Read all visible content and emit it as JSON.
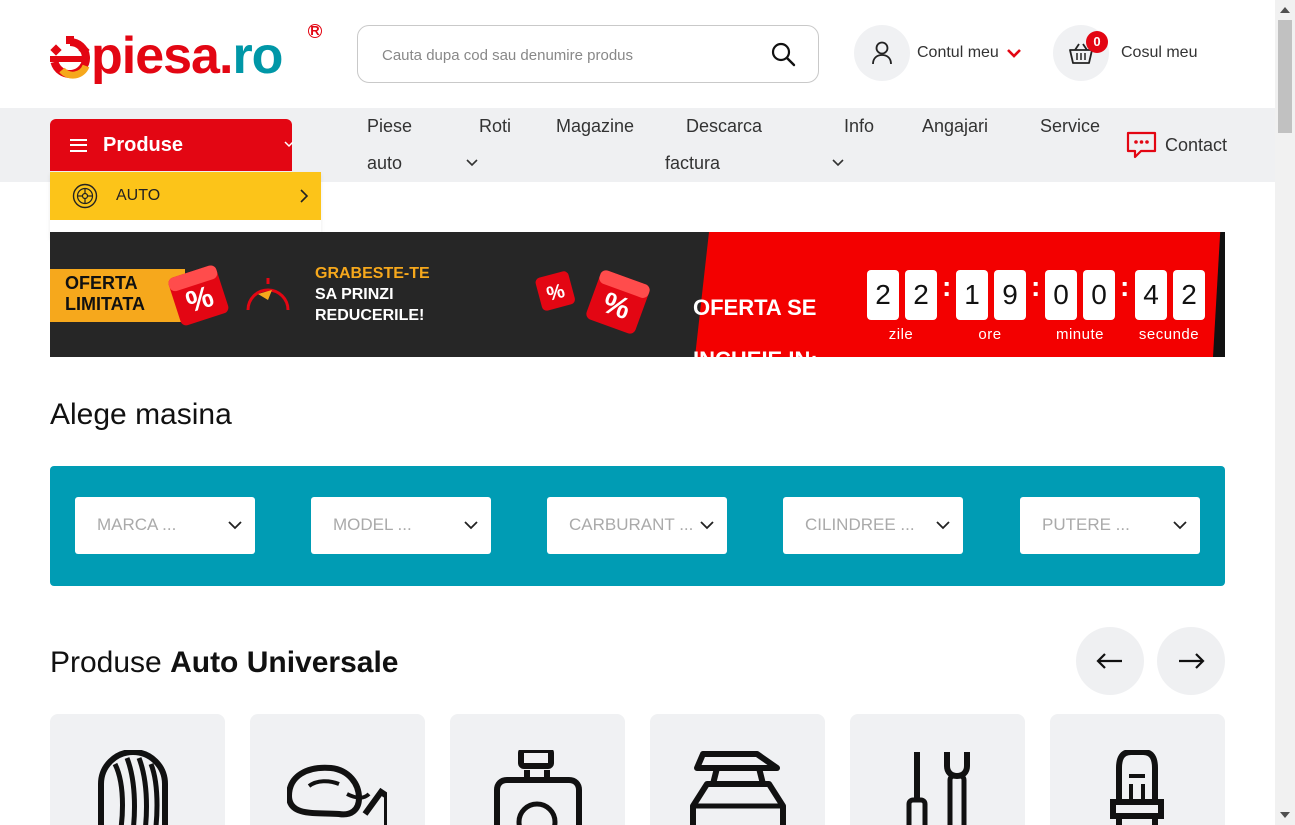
{
  "brand": {
    "logo_prefix": "e",
    "logo_main": "piesa",
    "logo_dot": ".",
    "logo_suffix": "ro",
    "registered": "R"
  },
  "search": {
    "placeholder": "Cauta dupa cod sau denumire produs"
  },
  "account": {
    "label": "Contul meu"
  },
  "cart": {
    "label": "Cosul meu",
    "count": "0"
  },
  "nav": {
    "produse_label": "Produse",
    "items": [
      {
        "label": "Piese",
        "label2": "auto",
        "has_dropdown": true
      },
      {
        "label": "Roti",
        "has_dropdown": false
      },
      {
        "label": "Magazine",
        "has_dropdown": false
      },
      {
        "label": "Descarca",
        "label2": "factura",
        "has_dropdown": true
      },
      {
        "label": "Info",
        "has_dropdown": false
      },
      {
        "label": "Angajari",
        "has_dropdown": false
      },
      {
        "label": "Service",
        "has_dropdown": false
      }
    ],
    "contact_label": "Contact"
  },
  "dropdown": {
    "auto_label": "AUTO"
  },
  "banner": {
    "tag_line1": "OFERTA",
    "tag_line2": "LIMITATA",
    "grab_line1": "GRABESTE-TE",
    "grab_line2": "SA PRINZI",
    "grab_line3": "REDUCERILE!",
    "ends_line1": "OFERTA SE",
    "ends_line2": "INCHEIE IN:",
    "digits": [
      "2",
      "2",
      "1",
      "9",
      "0",
      "0",
      "4",
      "2"
    ],
    "units": [
      "zile",
      "ore",
      "minute",
      "secunde"
    ],
    "separator": ":"
  },
  "car_select": {
    "title": "Alege masina",
    "fields": [
      "MARCA ...",
      "MODEL ...",
      "CARBURANT ...",
      "CILINDREE ...",
      "PUTERE ..."
    ]
  },
  "products": {
    "title_normal": "Produse ",
    "title_bold": "Auto Universale",
    "cards": [
      "tire-icon",
      "mirror-icon",
      "fluid-icon",
      "roof-box-icon",
      "tools-icon",
      "bulb-icon"
    ]
  },
  "colors": {
    "brand_red": "#e30613",
    "brand_teal": "#0097a7",
    "accent_yellow": "#fcc419",
    "car_select_bg": "#009cb4",
    "banner_dark": "#262626",
    "banner_red": "#f30000"
  }
}
